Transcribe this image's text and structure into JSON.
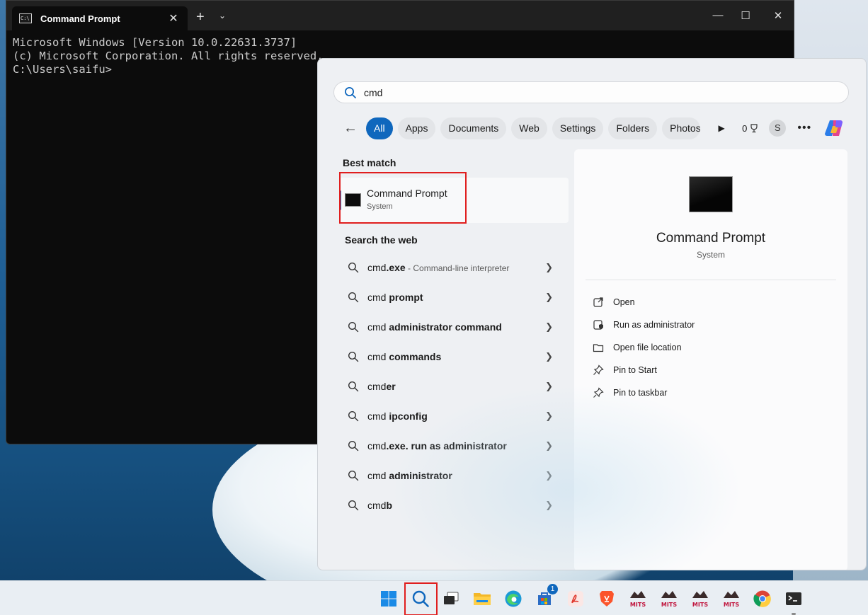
{
  "terminal": {
    "tab_title": "Command Prompt",
    "lines": [
      "Microsoft Windows [Version 10.0.22631.3737]",
      "(c) Microsoft Corporation. All rights reserved.",
      "",
      "C:\\Users\\saifu>"
    ]
  },
  "search": {
    "query": "cmd",
    "filters": [
      "All",
      "Apps",
      "Documents",
      "Web",
      "Settings",
      "Folders",
      "Photos"
    ],
    "active_filter": "All",
    "points": "0",
    "avatar_initial": "S"
  },
  "best_match": {
    "section_title": "Best match",
    "title": "Command Prompt",
    "subtitle": "System"
  },
  "web": {
    "section_title": "Search the web",
    "items": [
      {
        "plain": "cmd",
        "bold": ".exe",
        "desc": " - Command-line interpreter"
      },
      {
        "plain": "cmd ",
        "bold": "prompt",
        "desc": ""
      },
      {
        "plain": "cmd ",
        "bold": "administrator command",
        "desc": ""
      },
      {
        "plain": "cmd ",
        "bold": "commands",
        "desc": ""
      },
      {
        "plain": "cmd",
        "bold": "er",
        "desc": ""
      },
      {
        "plain": "cmd ",
        "bold": "ipconfig",
        "desc": ""
      },
      {
        "plain": "cmd",
        "bold": ".exe. run as administrator",
        "desc": ""
      },
      {
        "plain": "cmd ",
        "bold": "administrator",
        "desc": ""
      },
      {
        "plain": "cmd",
        "bold": "b",
        "desc": ""
      }
    ]
  },
  "detail": {
    "title": "Command Prompt",
    "subtitle": "System",
    "actions": [
      "Open",
      "Run as administrator",
      "Open file location",
      "Pin to Start",
      "Pin to taskbar"
    ]
  },
  "taskbar": {
    "store_badge": "1",
    "pinned_icons": [
      "windows-start-icon",
      "search-icon",
      "task-view-icon",
      "file-explorer-icon",
      "edge-icon",
      "microsoft-store-icon",
      "acrobat-icon",
      "brave-icon",
      "mits-app-icon",
      "mits-app-icon",
      "mits-app-icon",
      "mits-app-icon",
      "chrome-icon",
      "terminal-icon"
    ]
  },
  "colors": {
    "accent": "#0f67bd",
    "highlight": "#e01e1e"
  }
}
